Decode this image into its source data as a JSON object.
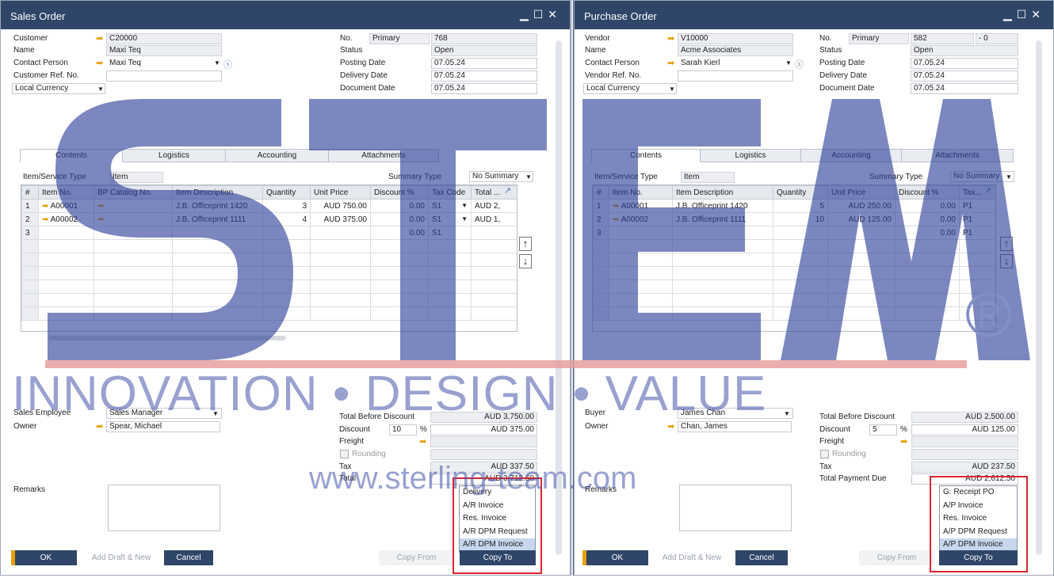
{
  "colors": {
    "titlebar": "#2f4669",
    "accent": "#e8a000",
    "highlight_box": "#d9262f",
    "watermark": "#2d3f99"
  },
  "so": {
    "title": "Sales Order",
    "header": {
      "customer_label": "Customer",
      "customer": "C20000",
      "name_label": "Name",
      "name": "Maxi Teq",
      "contact_label": "Contact Person",
      "contact": "Maxi Teq",
      "ref_label": "Customer Ref. No.",
      "ref": "",
      "currency": "Local Currency",
      "no_label": "No.",
      "series": "Primary",
      "no": "768",
      "status_label": "Status",
      "status": "Open",
      "posting_label": "Posting Date",
      "posting": "07.05.24",
      "delivery_label": "Delivery Date",
      "delivery": "07.05.24",
      "document_label": "Document Date",
      "document": "07.05.24"
    },
    "tabs": [
      "Contents",
      "Logistics",
      "Accounting",
      "Attachments"
    ],
    "item_type_label": "Item/Service Type",
    "item_type": "Item",
    "summary_label": "Summary Type",
    "summary": "No Summary",
    "columns": [
      "#",
      "Item No.",
      "BP Catalog No.",
      "Item Description",
      "Quantity",
      "Unit Price",
      "Discount %",
      "Tax Code",
      "Total ..."
    ],
    "rows": [
      {
        "n": "1",
        "item": "A00001",
        "desc": "J.B. Officeprint 1420",
        "qty": "3",
        "price": "AUD 750.00",
        "disc": "0.00",
        "tax": "S1",
        "total": "AUD 2,"
      },
      {
        "n": "2",
        "item": "A00002",
        "desc": "J.B. Officeprint 1111",
        "qty": "4",
        "price": "AUD 375.00",
        "disc": "0.00",
        "tax": "S1",
        "total": "AUD 1,"
      },
      {
        "n": "3",
        "item": "",
        "desc": "",
        "qty": "",
        "price": "",
        "disc": "0.00",
        "tax": "S1",
        "total": ""
      }
    ],
    "footer": {
      "emp_label": "Sales Employee",
      "emp": "Sales Manager",
      "owner_label": "Owner",
      "owner": "Spear, Michael",
      "remarks_label": "Remarks",
      "tbd_label": "Total Before Discount",
      "tbd": "AUD 3,750.00",
      "disc_label": "Discount",
      "disc_pct": "10",
      "pct": "%",
      "disc_amt": "AUD 375.00",
      "freight_label": "Freight",
      "rounding_label": "Rounding",
      "tax_label": "Tax",
      "tax": "AUD 337.50",
      "total_label": "Total",
      "total": "AUD 3,712.50"
    },
    "buttons": {
      "ok": "OK",
      "draft": "Add Draft & New",
      "cancel": "Cancel",
      "copy_from": "Copy From",
      "copy_to": "Copy To"
    },
    "menu": [
      "Delivery",
      "A/R Invoice",
      "Res. Invoice",
      "A/R DPM Request",
      "A/R DPM Invoice"
    ]
  },
  "po": {
    "title": "Purchase Order",
    "header": {
      "vendor_label": "Vendor",
      "vendor": "V10000",
      "name_label": "Name",
      "name": "Acme Associates",
      "contact_label": "Contact Person",
      "contact": "Sarah Kierl",
      "ref_label": "Vendor Ref. No.",
      "ref": "",
      "currency": "Local Currency",
      "no_label": "No.",
      "series": "Primary",
      "no": "582",
      "no2": "- 0",
      "status_label": "Status",
      "status": "Open",
      "posting_label": "Posting Date",
      "posting": "07.05.24",
      "delivery_label": "Delivery Date",
      "delivery": "07.05.24",
      "document_label": "Document Date",
      "document": "07.05.24"
    },
    "tabs": [
      "Contents",
      "Logistics",
      "Accounting",
      "Attachments"
    ],
    "item_type_label": "Item/Service Type",
    "item_type": "Item",
    "summary_label": "Summary Type",
    "summary": "No Summary",
    "columns": [
      "#",
      "Item No.",
      "Item Description",
      "Quantity",
      "Unit Price",
      "Discount %",
      "Tax..."
    ],
    "rows": [
      {
        "n": "1",
        "item": "A00001",
        "desc": "J.B. Officeprint 1420",
        "qty": "5",
        "price": "AUD 250.00",
        "disc": "0.00",
        "tax": "P1"
      },
      {
        "n": "2",
        "item": "A00002",
        "desc": "J.B. Officeprint 1111",
        "qty": "10",
        "price": "AUD 125.00",
        "disc": "0.00",
        "tax": "P1"
      },
      {
        "n": "3",
        "item": "",
        "desc": "",
        "qty": "",
        "price": "",
        "disc": "0.00",
        "tax": "P1"
      }
    ],
    "footer": {
      "buyer_label": "Buyer",
      "buyer": "James Chan",
      "owner_label": "Owner",
      "owner": "Chan, James",
      "remarks_label": "Remarks",
      "tbd_label": "Total Before Discount",
      "tbd": "AUD 2,500.00",
      "disc_label": "Discount",
      "disc_pct": "5",
      "pct": "%",
      "disc_amt": "AUD 125.00",
      "freight_label": "Freight",
      "rounding_label": "Rounding",
      "tax_label": "Tax",
      "tax": "AUD 237.50",
      "total_label": "Total Payment Due",
      "total": "AUD 2,612.50"
    },
    "buttons": {
      "ok": "OK",
      "draft": "Add Draft & New",
      "cancel": "Cancel",
      "copy_from": "Copy From",
      "copy_to": "Copy To"
    },
    "menu": [
      "G. Receipt PO",
      "A/P Invoice",
      "Res. Invoice",
      "A/P DPM Request",
      "A/P DPM Invoice"
    ]
  },
  "watermark": {
    "reg": "®",
    "tagline": "INNOVATION • DESIGN • VALUE",
    "url": "www.sterling-team.com"
  }
}
